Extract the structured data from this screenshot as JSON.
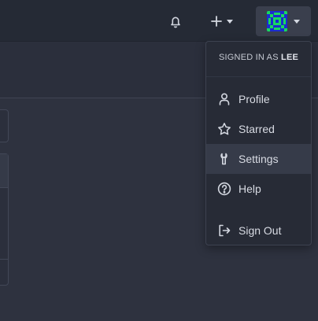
{
  "header": {
    "notifications_icon": "bell-icon",
    "create_icon": "plus-icon",
    "avatar_icon": "user-avatar-identicon",
    "avatar_colors": [
      "#19d85f",
      "#1b2cd0"
    ]
  },
  "user_menu": {
    "signed_in_prefix": "SIGNED IN AS",
    "username": "LEE",
    "items": [
      {
        "label": "Profile",
        "icon": "person-icon"
      },
      {
        "label": "Starred",
        "icon": "star-icon"
      },
      {
        "label": "Settings",
        "icon": "wrench-icon",
        "active": true
      },
      {
        "label": "Help",
        "icon": "question-circle-icon"
      },
      {
        "label": "Sign Out",
        "icon": "sign-out-icon"
      }
    ]
  },
  "colors": {
    "background": "#2e323f",
    "topbar": "#252a35",
    "dropdown_bg": "#272b36",
    "hover_bg": "#363b49",
    "text": "#d8dbe3"
  }
}
